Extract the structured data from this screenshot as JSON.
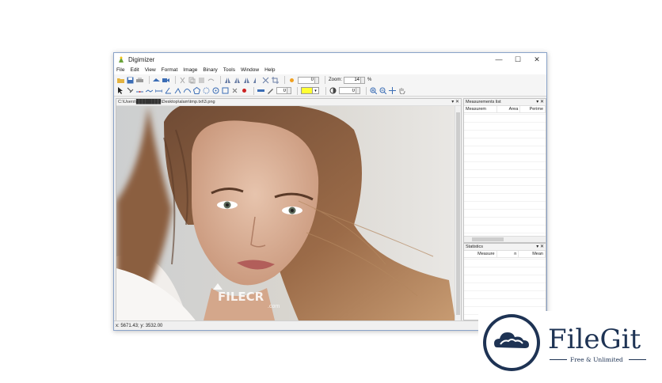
{
  "window": {
    "title": "Digimizer",
    "controls": [
      "—",
      "☐",
      "✕"
    ]
  },
  "menu": [
    "File",
    "Edit",
    "View",
    "Format",
    "Image",
    "Binary",
    "Tools",
    "Window",
    "Help"
  ],
  "toolbar": {
    "brightness_value": "0",
    "zoom_label": "Zoom:",
    "zoom_value": "14",
    "zoom_unit": "%",
    "line_width_value": "0",
    "contrast_value": "0",
    "color_accent": "#ffff33"
  },
  "document": {
    "path": "C:\\Users\\████████\\Desktop\\alam\\tmp.txt\\3.png",
    "pin": "▾ ✕",
    "watermark": "FILECR",
    "watermark_sub": ".com"
  },
  "measurements": {
    "title": "Measurements list",
    "columns": [
      "Measurem",
      "Area",
      "Perime"
    ],
    "pin": "▾ ✕"
  },
  "statistics": {
    "title": "Statistics",
    "columns": [
      "Measure",
      "n",
      "Mean"
    ],
    "pin": "▾ ✕"
  },
  "status": {
    "coordinates": "x: 5671.43; y: 3532.00"
  },
  "branding": {
    "name": "FileGit",
    "tagline": "Free & Unlimited",
    "color": "#1e3354"
  }
}
